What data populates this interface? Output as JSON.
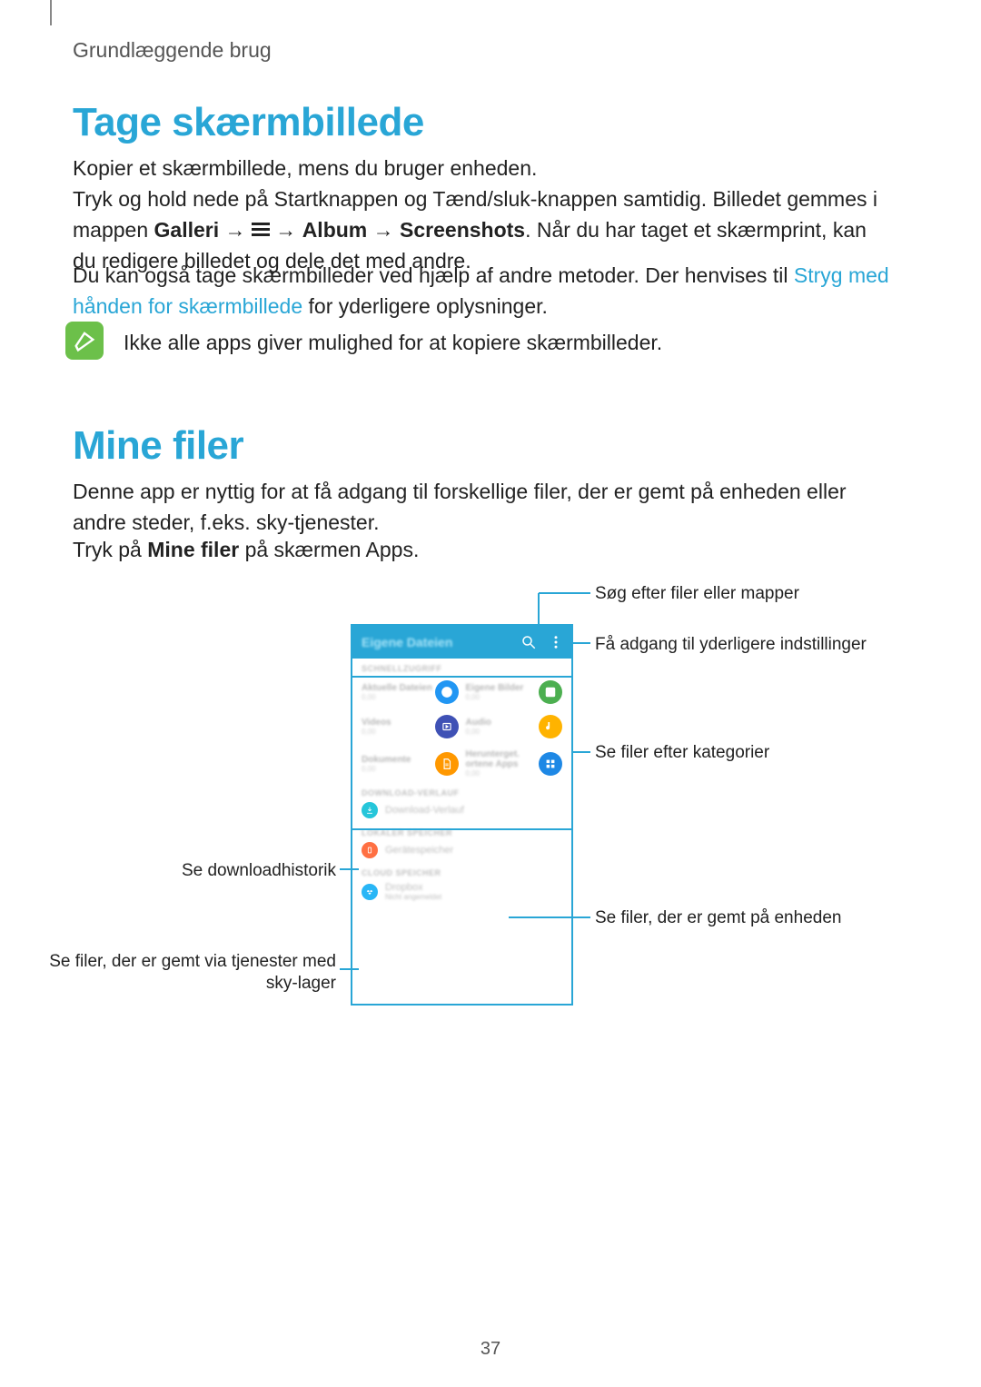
{
  "header": {
    "section_label": "Grundlæggende brug"
  },
  "sections": {
    "screenshot": {
      "title": "Tage skærmbillede",
      "p1": "Kopier et skærmbillede, mens du bruger enheden.",
      "p2a": "Tryk og hold nede på Startknappen og Tænd/sluk-knappen samtidig. Billedet gemmes i mappen ",
      "p2_bold1": "Galleri",
      "p2_arrow": " → ",
      "p2_bold2": "Album",
      "p2_bold3": "Screenshots",
      "p2b": ". Når du har taget et skærmprint, kan du redigere billedet og dele det med andre.",
      "p3a": "Du kan også tage skærmbilleder ved hjælp af andre metoder. Der henvises til ",
      "p3_link": "Stryg med hånden for skærmbillede",
      "p3b": " for yderligere oplysninger.",
      "note": "Ikke alle apps giver mulighed for at kopiere skærmbilleder."
    },
    "myfiles": {
      "title": "Mine filer",
      "p1": "Denne app er nyttig for at få adgang til forskellige filer, der er gemt på enheden eller andre steder, f.eks. sky-tjenester.",
      "p2a": "Tryk på ",
      "p2_bold": "Mine filer",
      "p2b": " på skærmen Apps."
    }
  },
  "annotations": {
    "search": "Søg efter filer eller mapper",
    "more": "Få adgang til yderligere indstillinger",
    "categories": "Se filer efter kategorier",
    "downloads": "Se downloadhistorik",
    "device": "Se filer, der er gemt på enheden",
    "cloud": "Se filer, der er gemt via tjenester med sky-lager"
  },
  "phone": {
    "title": "Eigene Dateien",
    "sec1": "SCHNELLZUGRIFF",
    "cats": [
      {
        "t": "Aktuelle Dateien",
        "s": "0,00"
      },
      {
        "t": "Eigene Bilder",
        "s": "0,00"
      },
      {
        "t": "Videos",
        "s": "0,00"
      },
      {
        "t": "Audio",
        "s": "0,00"
      },
      {
        "t": "Dokumente",
        "s": "0,00"
      },
      {
        "t": "Herunterget. ortene Apps",
        "s": "0,00"
      }
    ],
    "sec2": "DOWNLOAD-VERLAUF",
    "row_download": "Download-Verlauf",
    "sec3": "LOKALER SPEICHER",
    "row_device": "Gerätespeicher",
    "sec4": "CLOUD SPEICHER",
    "row_cloud": "Dropbox",
    "row_cloud_sub": "Nicht angemeldet"
  },
  "page_number": "37"
}
